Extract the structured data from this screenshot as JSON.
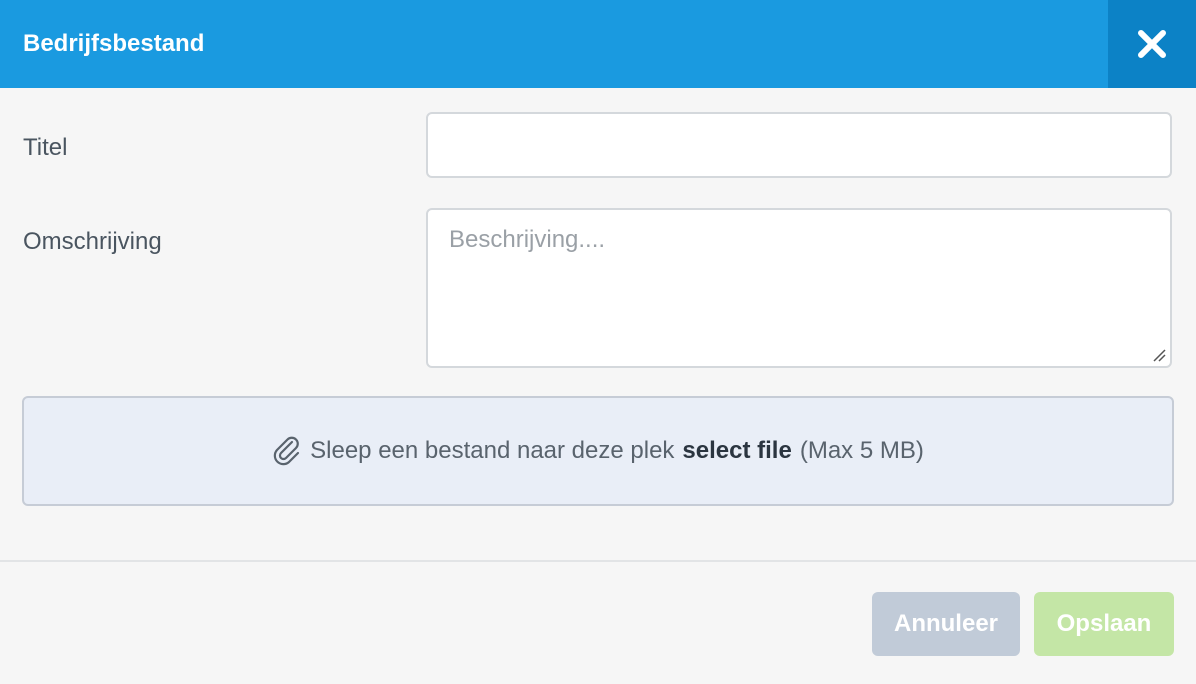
{
  "dialog": {
    "title": "Bedrijfsbestand",
    "close_icon": "close-icon"
  },
  "form": {
    "title_label": "Titel",
    "title_value": "",
    "description_label": "Omschrijving",
    "description_placeholder": "Beschrijving....",
    "description_value": ""
  },
  "dropzone": {
    "icon": "paperclip-icon",
    "text": "Sleep een bestand naar deze plek",
    "select_text": "select file",
    "limit_text": "(Max 5 MB)"
  },
  "footer": {
    "cancel_label": "Annuleer",
    "save_label": "Opslaan"
  },
  "colors": {
    "header": "#1a9ae0",
    "close_button": "#0c82c6",
    "cancel_button": "#c1cbd8",
    "save_button": "#c4e6a6",
    "dropzone_bg": "#e9eef7"
  }
}
